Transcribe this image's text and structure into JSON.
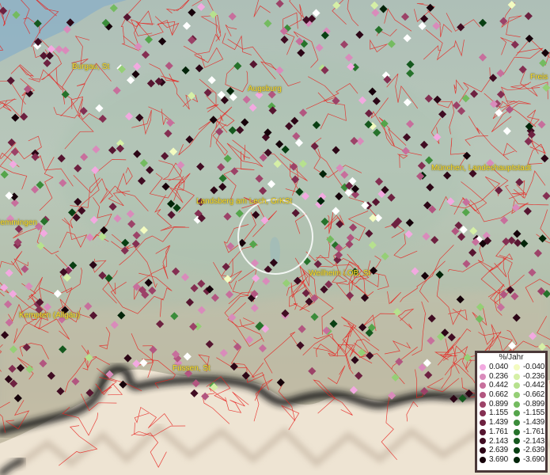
{
  "map": {
    "places": [
      {
        "id": "burgau",
        "label": "Burgau, St"
      },
      {
        "id": "augsburg",
        "label": "Augsburg"
      },
      {
        "id": "freising",
        "label": "Freis"
      },
      {
        "id": "muenchen",
        "label": "München, Landeshauptstadt"
      },
      {
        "id": "landsberg",
        "label": "Landsberg am Lech, GrKSt"
      },
      {
        "id": "memmingen",
        "label": "Memmingen"
      },
      {
        "id": "weilheim",
        "label": "Weilheim i.OB, St"
      },
      {
        "id": "kempten",
        "label": "Kempten (Allgäu)"
      },
      {
        "id": "fuessen",
        "label": "Füssen, St"
      }
    ]
  },
  "legend": {
    "title": "%/Jahr",
    "positive": [
      {
        "value": "0.040",
        "color": "#f2a9e0"
      },
      {
        "value": "0.236",
        "color": "#d98bbb"
      },
      {
        "value": "0.442",
        "color": "#c76f9c"
      },
      {
        "value": "0.662",
        "color": "#b25680"
      },
      {
        "value": "0.899",
        "color": "#9c4268"
      },
      {
        "value": "1.155",
        "color": "#842f52"
      },
      {
        "value": "1.439",
        "color": "#6d2140"
      },
      {
        "value": "1.761",
        "color": "#561530"
      },
      {
        "value": "2.143",
        "color": "#400c22"
      },
      {
        "value": "2.639",
        "color": "#2c0616"
      },
      {
        "value": "3.690",
        "color": "#16020a"
      }
    ],
    "negative": [
      {
        "value": "-0.040",
        "color": "#f3fbc0"
      },
      {
        "value": "-0.236",
        "color": "#d5efa6"
      },
      {
        "value": "-0.442",
        "color": "#b6e18e"
      },
      {
        "value": "-0.662",
        "color": "#95cf76"
      },
      {
        "value": "-0.899",
        "color": "#74bb60"
      },
      {
        "value": "-1.155",
        "color": "#55a54b"
      },
      {
        "value": "-1.439",
        "color": "#3b8c3a"
      },
      {
        "value": "-1.761",
        "color": "#26722b"
      },
      {
        "value": "-2.143",
        "color": "#15581e"
      },
      {
        "value": "-2.639",
        "color": "#093f13"
      },
      {
        "value": "-3.690",
        "color": "#022409"
      }
    ]
  },
  "colors": {
    "boundary": "#e8221e",
    "label": "#ffdf2a",
    "alps_shadow": "#1c1c1c",
    "alps_snow": "#efe6d7",
    "lowland": "#b7c5b9",
    "water": "#7ea7c5"
  }
}
